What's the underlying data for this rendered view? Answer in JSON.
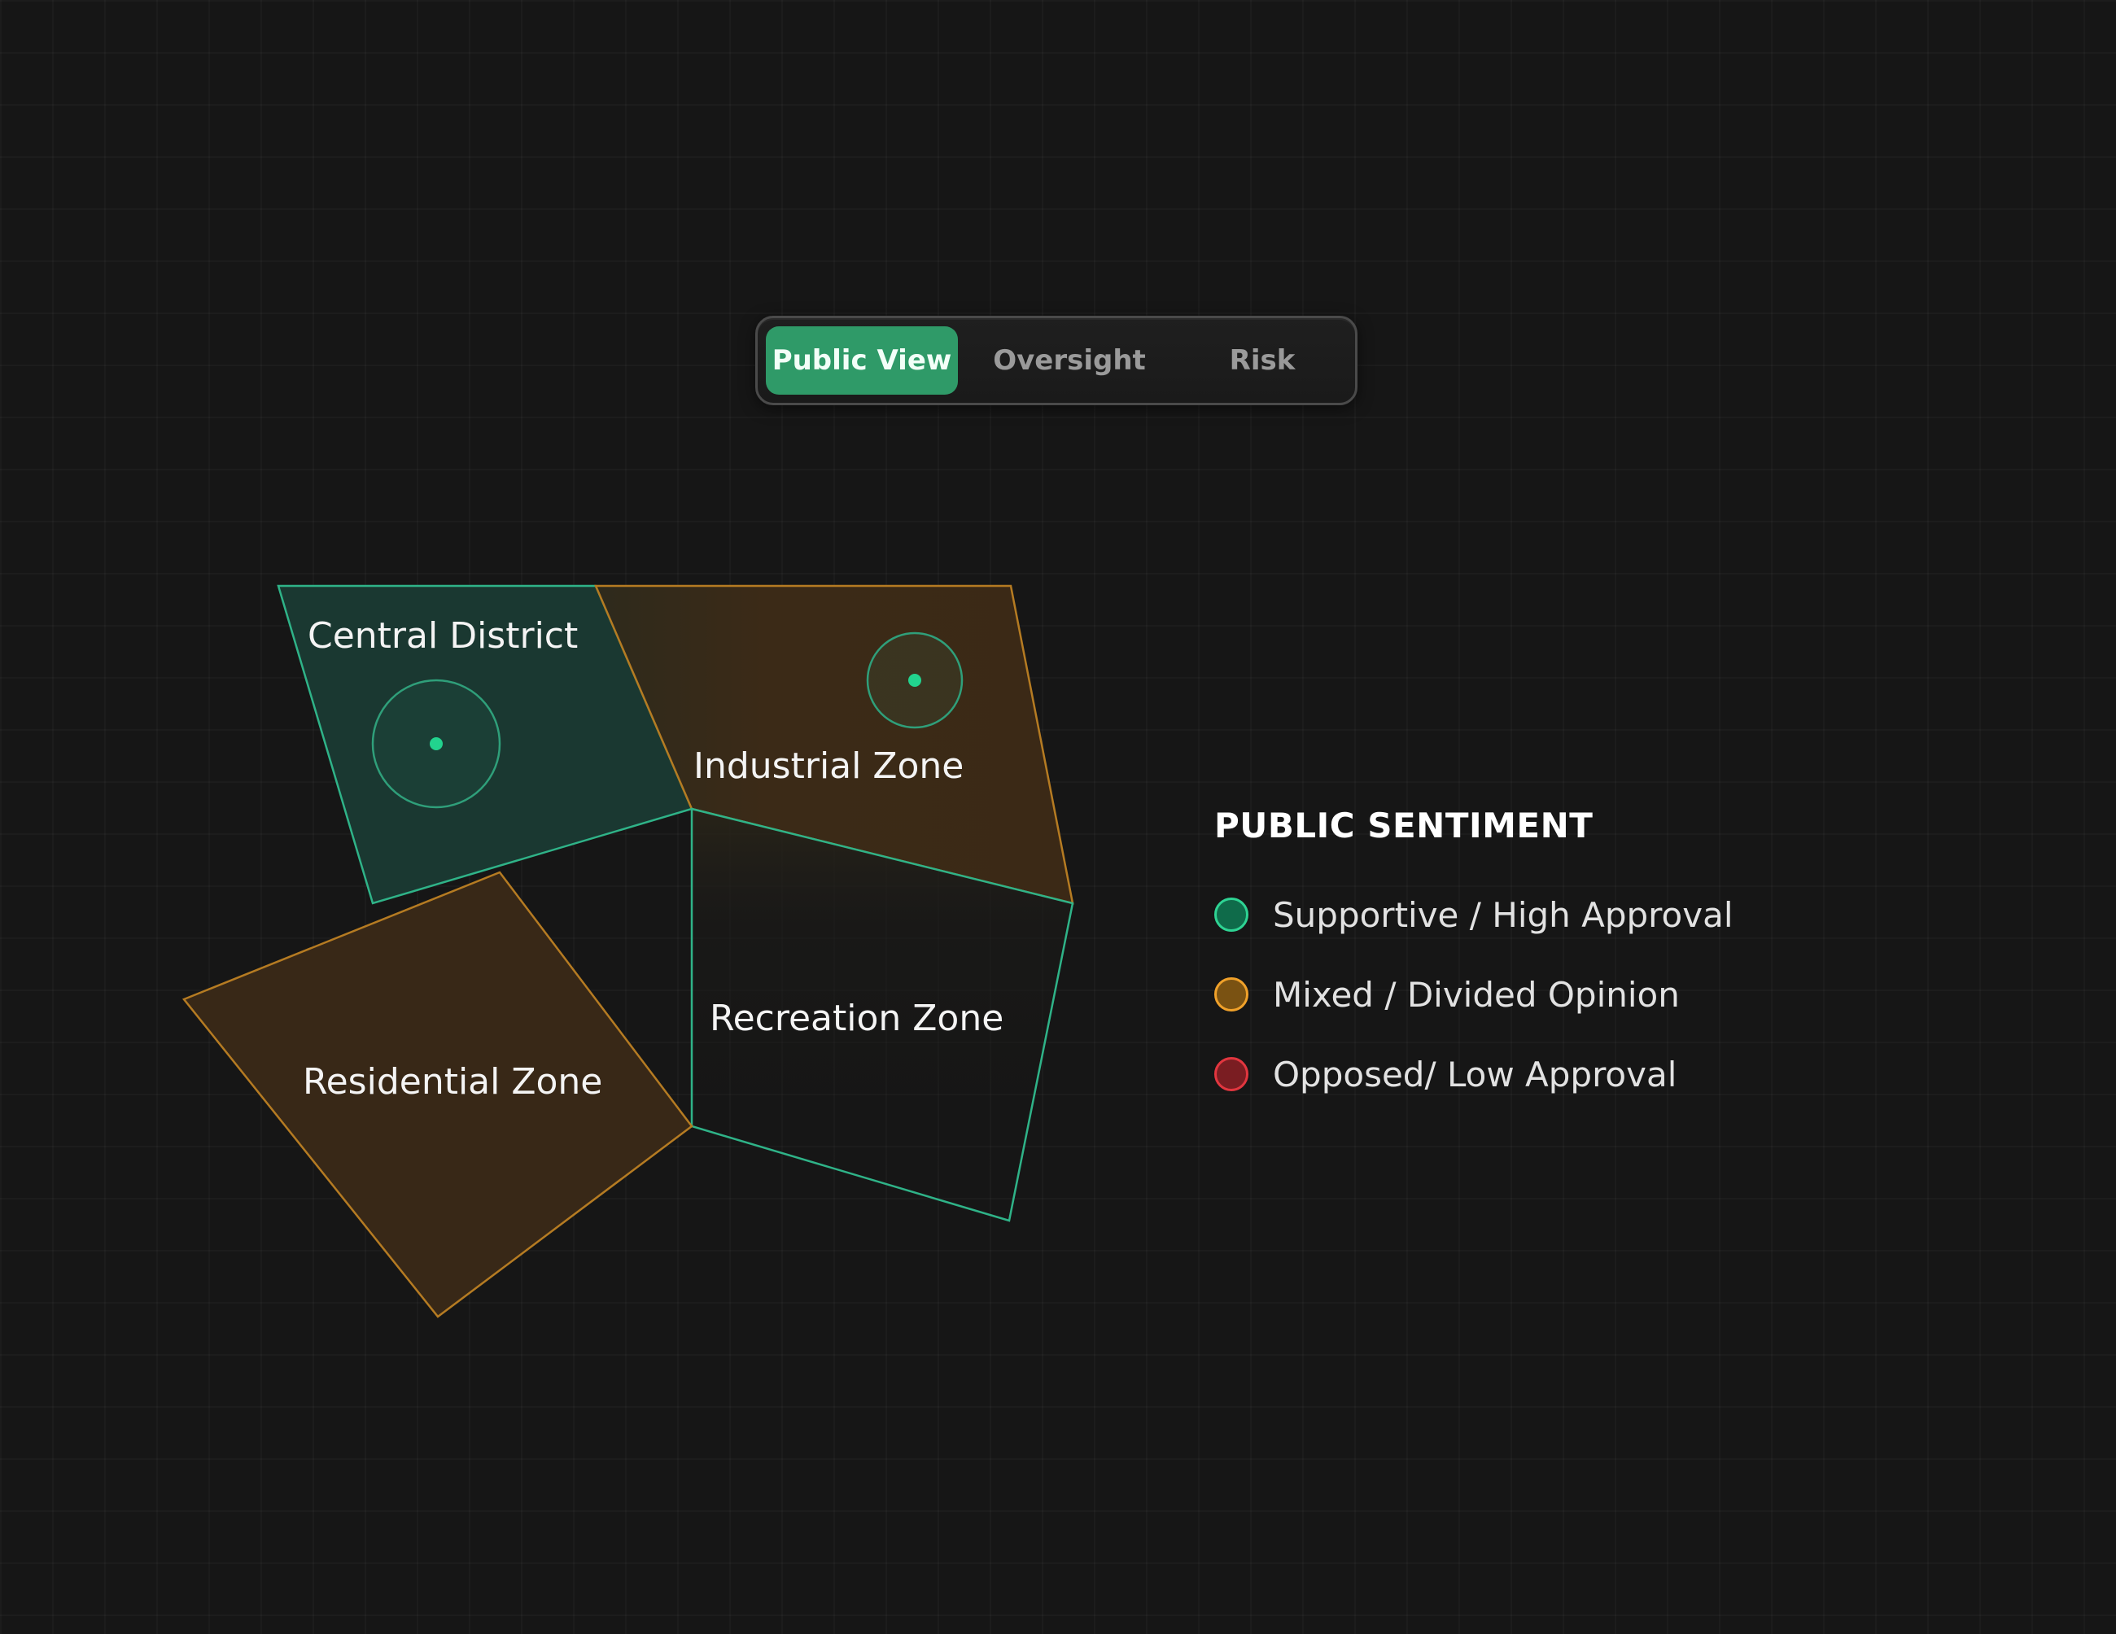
{
  "toolbar": {
    "tabs": [
      {
        "label": "Public View",
        "active": true
      },
      {
        "label": "Oversight",
        "active": false
      },
      {
        "label": "Risk",
        "active": false
      }
    ],
    "active_color": "#2f9a68"
  },
  "map": {
    "zones": [
      {
        "id": "central",
        "label": "Central District",
        "sentiment": "supportive",
        "has_marker": true
      },
      {
        "id": "industrial",
        "label": "Industrial Zone",
        "sentiment": "mixed",
        "has_marker": true
      },
      {
        "id": "recreation",
        "label": "Recreation Zone",
        "sentiment": "supportive",
        "has_marker": false
      },
      {
        "id": "residential",
        "label": "Residential Zone",
        "sentiment": "mixed",
        "has_marker": false
      }
    ],
    "colors": {
      "supportive_stroke": "#35c08f",
      "supportive_fill": "#1a3a31",
      "mixed_stroke": "#c98a2a",
      "mixed_fill": "#3a2a17",
      "marker_dot": "#22d38e"
    }
  },
  "legend": {
    "title": "PUBLIC SENTIMENT",
    "items": [
      {
        "label": "Supportive / High Approval",
        "fill": "#0f6b4a",
        "stroke": "#2ed393"
      },
      {
        "label": "Mixed / Divided Opinion",
        "fill": "#7a5212",
        "stroke": "#f0a12a"
      },
      {
        "label": "Opposed/ Low Approval",
        "fill": "#7a1d22",
        "stroke": "#e2363f"
      }
    ]
  }
}
